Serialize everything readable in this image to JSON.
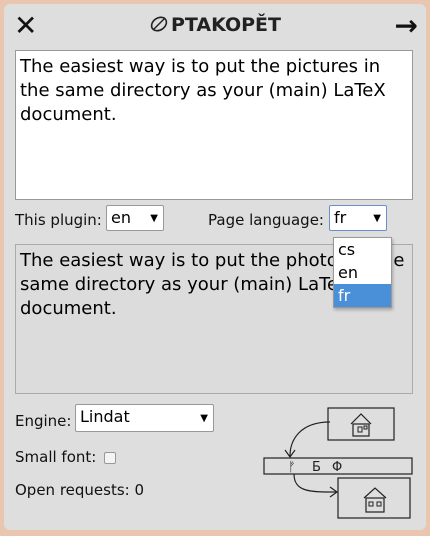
{
  "app": {
    "title": "PTAKOPĚT"
  },
  "toolbar": {
    "close_glyph": "✕",
    "next_glyph": "→"
  },
  "source": {
    "text": "The easiest way is to put the pictures in the same directory as your (main) LaTeX document."
  },
  "plugin": {
    "label": "This plugin:",
    "selected": "en"
  },
  "page_language": {
    "label": "Page language:",
    "selected": "fr",
    "options": [
      "cs",
      "en",
      "fr"
    ],
    "highlighted": "fr"
  },
  "output": {
    "text": "The easiest way is to put the photos in the same directory as your (main) LaTeX document."
  },
  "engine": {
    "label": "Engine:",
    "selected": "Lindat"
  },
  "small_font": {
    "label": "Small font:",
    "checked": false
  },
  "requests": {
    "label": "Open requests: 0"
  },
  "diagram": {
    "glyphs": [
      "ᚠ",
      "Б",
      "Φ"
    ]
  }
}
